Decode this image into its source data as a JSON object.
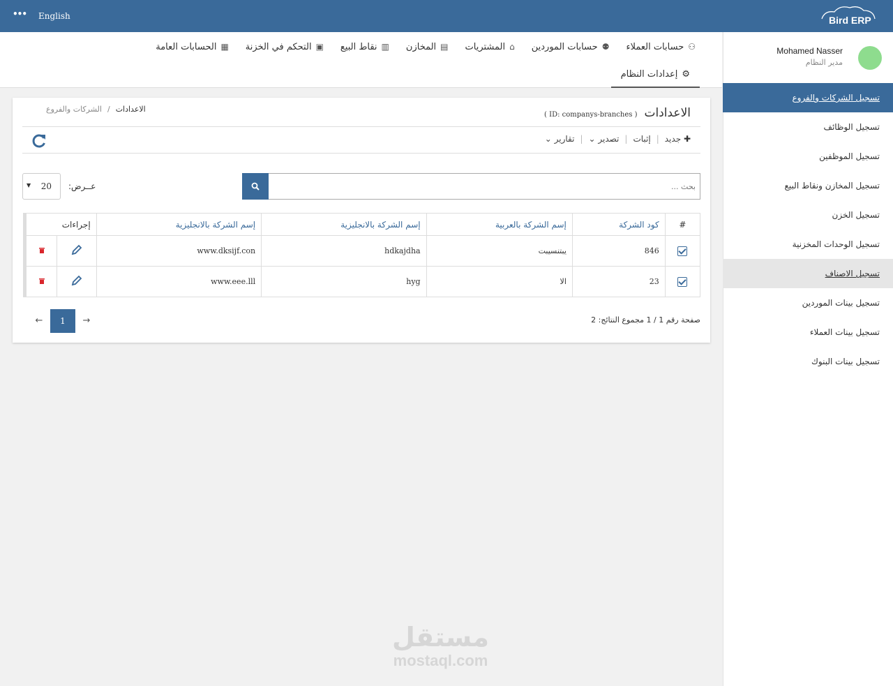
{
  "topbar": {
    "menu_icon": "ellipsis-icon",
    "lang": "English",
    "logo": "Bird ERP"
  },
  "user": {
    "name": "Mohamed Nasser",
    "role": "مدير النظام"
  },
  "sidebar": {
    "items": [
      {
        "label": "تسجيل الشركات والفروع"
      },
      {
        "label": "تسجيل الوظائف"
      },
      {
        "label": "تسجيل الموظفين"
      },
      {
        "label": "تسجيل المخازن ونقاط البيع"
      },
      {
        "label": "تسجيل الخزن"
      },
      {
        "label": "تسجيل الوحدات المخزنية"
      },
      {
        "label": "تسجيل الاصناف"
      },
      {
        "label": "تسجيل بينات الموردين"
      },
      {
        "label": "تسجيل بينات العملاء"
      },
      {
        "label": "تسجيل بينات البنوك"
      }
    ]
  },
  "modules": [
    {
      "label": "حسابات العملاء",
      "icon": "customers-icon"
    },
    {
      "label": "حسابات الموردين",
      "icon": "suppliers-icon"
    },
    {
      "label": "المشتريات",
      "icon": "basket-icon"
    },
    {
      "label": "المخازن",
      "icon": "warehouse-icon"
    },
    {
      "label": "نقاط البيع",
      "icon": "pos-icon"
    },
    {
      "label": "التحكم في الخزنة",
      "icon": "safe-icon"
    },
    {
      "label": "الحسابات العامة",
      "icon": "grid-icon"
    }
  ],
  "system_settings": "إعدادات النظام",
  "page": {
    "title": "الاعدادات",
    "id_label": "( ID: companys-branches )",
    "breadcrumb": {
      "root": "الاعدادات",
      "sep": "/",
      "current": "الشركات والفروع"
    }
  },
  "toolbar": {
    "new": "جديد",
    "confirm": "إثبات",
    "export": "تصدير",
    "reports": "تقارير"
  },
  "search": {
    "placeholder": "بحث ..."
  },
  "show": {
    "label": "عــرض:",
    "value": "20"
  },
  "table": {
    "headers": {
      "num": "#",
      "code": "كود الشركة",
      "name_ar": "إسم الشركة بالعربية",
      "name_en": "إسم الشركة بالانجليزية",
      "name_en2": "إسم الشركة بالانجليزية",
      "actions": "إجراءات"
    },
    "rows": [
      {
        "code": "846",
        "name_ar": "يبتنسيبت",
        "name_en": "hdkajdha",
        "website": "www.dksijf.con"
      },
      {
        "code": "23",
        "name_ar": "الا",
        "name_en": "hyg",
        "website": "www.eee.lll"
      }
    ]
  },
  "pagination": {
    "info": "صفحة رقم 1 / 1 مجموع النتائج: 2",
    "current": "1",
    "prev": "←",
    "next": "→"
  },
  "watermark": {
    "ar": "مستقل",
    "en": "mostaql.com"
  },
  "colors": {
    "primary": "#3a6a9a",
    "delete": "#d9262c"
  }
}
